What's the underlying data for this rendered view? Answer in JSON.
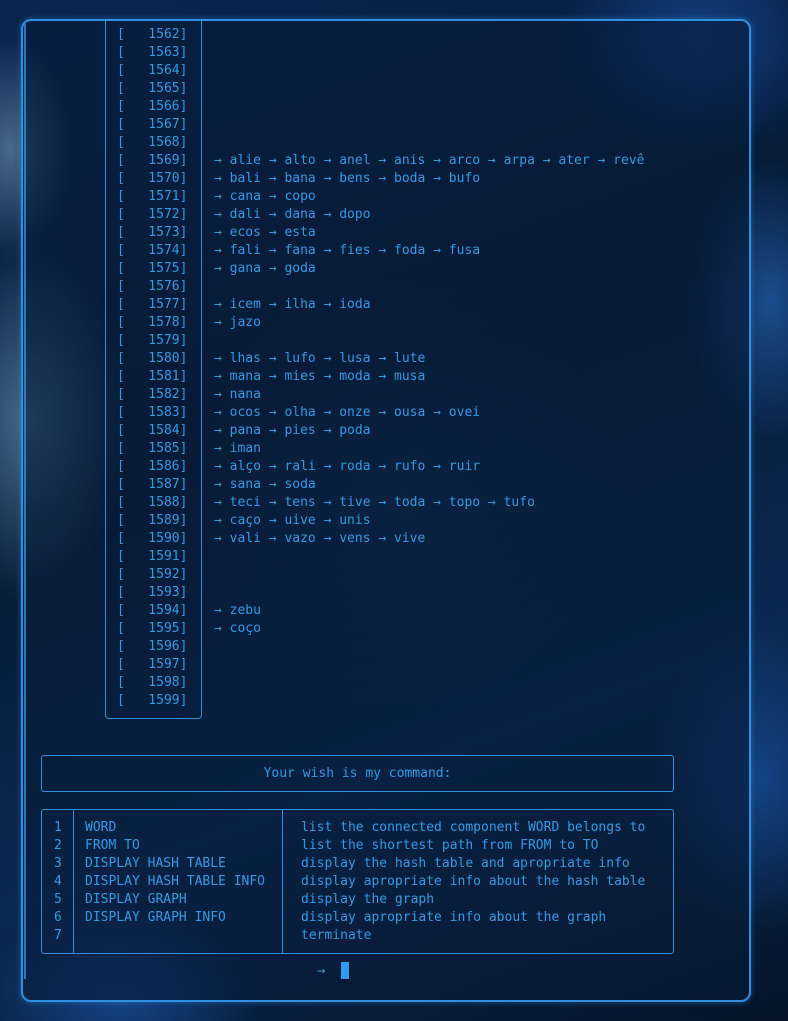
{
  "rows": [
    {
      "index": "1562",
      "words": []
    },
    {
      "index": "1563",
      "words": []
    },
    {
      "index": "1564",
      "words": []
    },
    {
      "index": "1565",
      "words": []
    },
    {
      "index": "1566",
      "words": []
    },
    {
      "index": "1567",
      "words": []
    },
    {
      "index": "1568",
      "words": []
    },
    {
      "index": "1569",
      "words": [
        "alie",
        "alto",
        "anel",
        "anis",
        "arco",
        "arpa",
        "ater",
        "revê"
      ]
    },
    {
      "index": "1570",
      "words": [
        "bali",
        "bana",
        "bens",
        "boda",
        "bufo"
      ]
    },
    {
      "index": "1571",
      "words": [
        "cana",
        "copo"
      ]
    },
    {
      "index": "1572",
      "words": [
        "dali",
        "dana",
        "dopo"
      ]
    },
    {
      "index": "1573",
      "words": [
        "ecos",
        "esta"
      ]
    },
    {
      "index": "1574",
      "words": [
        "fali",
        "fana",
        "fies",
        "foda",
        "fusa"
      ]
    },
    {
      "index": "1575",
      "words": [
        "gana",
        "goda"
      ]
    },
    {
      "index": "1576",
      "words": []
    },
    {
      "index": "1577",
      "words": [
        "icem",
        "ilha",
        "ioda"
      ]
    },
    {
      "index": "1578",
      "words": [
        "jazo"
      ]
    },
    {
      "index": "1579",
      "words": []
    },
    {
      "index": "1580",
      "words": [
        "lhas",
        "lufo",
        "lusa",
        "lute"
      ]
    },
    {
      "index": "1581",
      "words": [
        "mana",
        "mies",
        "moda",
        "musa"
      ]
    },
    {
      "index": "1582",
      "words": [
        "nana"
      ]
    },
    {
      "index": "1583",
      "words": [
        "ocos",
        "olha",
        "onze",
        "ousa",
        "ovei"
      ]
    },
    {
      "index": "1584",
      "words": [
        "pana",
        "pies",
        "poda"
      ]
    },
    {
      "index": "1585",
      "words": [
        "iman"
      ]
    },
    {
      "index": "1586",
      "words": [
        "alço",
        "rali",
        "roda",
        "rufo",
        "ruir"
      ]
    },
    {
      "index": "1587",
      "words": [
        "sana",
        "soda"
      ]
    },
    {
      "index": "1588",
      "words": [
        "teci",
        "tens",
        "tive",
        "toda",
        "topo",
        "tufo"
      ]
    },
    {
      "index": "1589",
      "words": [
        "caço",
        "uive",
        "unis"
      ]
    },
    {
      "index": "1590",
      "words": [
        "vali",
        "vazo",
        "vens",
        "vive"
      ]
    },
    {
      "index": "1591",
      "words": []
    },
    {
      "index": "1592",
      "words": []
    },
    {
      "index": "1593",
      "words": []
    },
    {
      "index": "1594",
      "words": [
        "zebu"
      ]
    },
    {
      "index": "1595",
      "words": [
        "coço"
      ]
    },
    {
      "index": "1596",
      "words": []
    },
    {
      "index": "1597",
      "words": []
    },
    {
      "index": "1598",
      "words": []
    },
    {
      "index": "1599",
      "words": []
    }
  ],
  "arrow": "→",
  "command_prompt": "Your wish is my command:",
  "help": [
    {
      "num": "1",
      "cmd": "WORD",
      "desc": "list the connected component WORD belongs to"
    },
    {
      "num": "2",
      "cmd": "FROM TO",
      "desc": "list the shortest path from FROM to TO"
    },
    {
      "num": "3",
      "cmd": "DISPLAY HASH TABLE",
      "desc": "display the hash table and apropriate info"
    },
    {
      "num": "4",
      "cmd": "DISPLAY HASH TABLE INFO",
      "desc": "display apropriate info about the hash table"
    },
    {
      "num": "5",
      "cmd": "DISPLAY GRAPH",
      "desc": "display the graph"
    },
    {
      "num": "6",
      "cmd": "DISPLAY GRAPH INFO",
      "desc": "display apropriate info about the graph"
    },
    {
      "num": "7",
      "cmd": "",
      "desc": "terminate"
    }
  ],
  "input": {
    "prompt_symbol": "→",
    "value": ""
  },
  "colors": {
    "accent": "#2f8fe0",
    "text": "#2e9be8"
  }
}
